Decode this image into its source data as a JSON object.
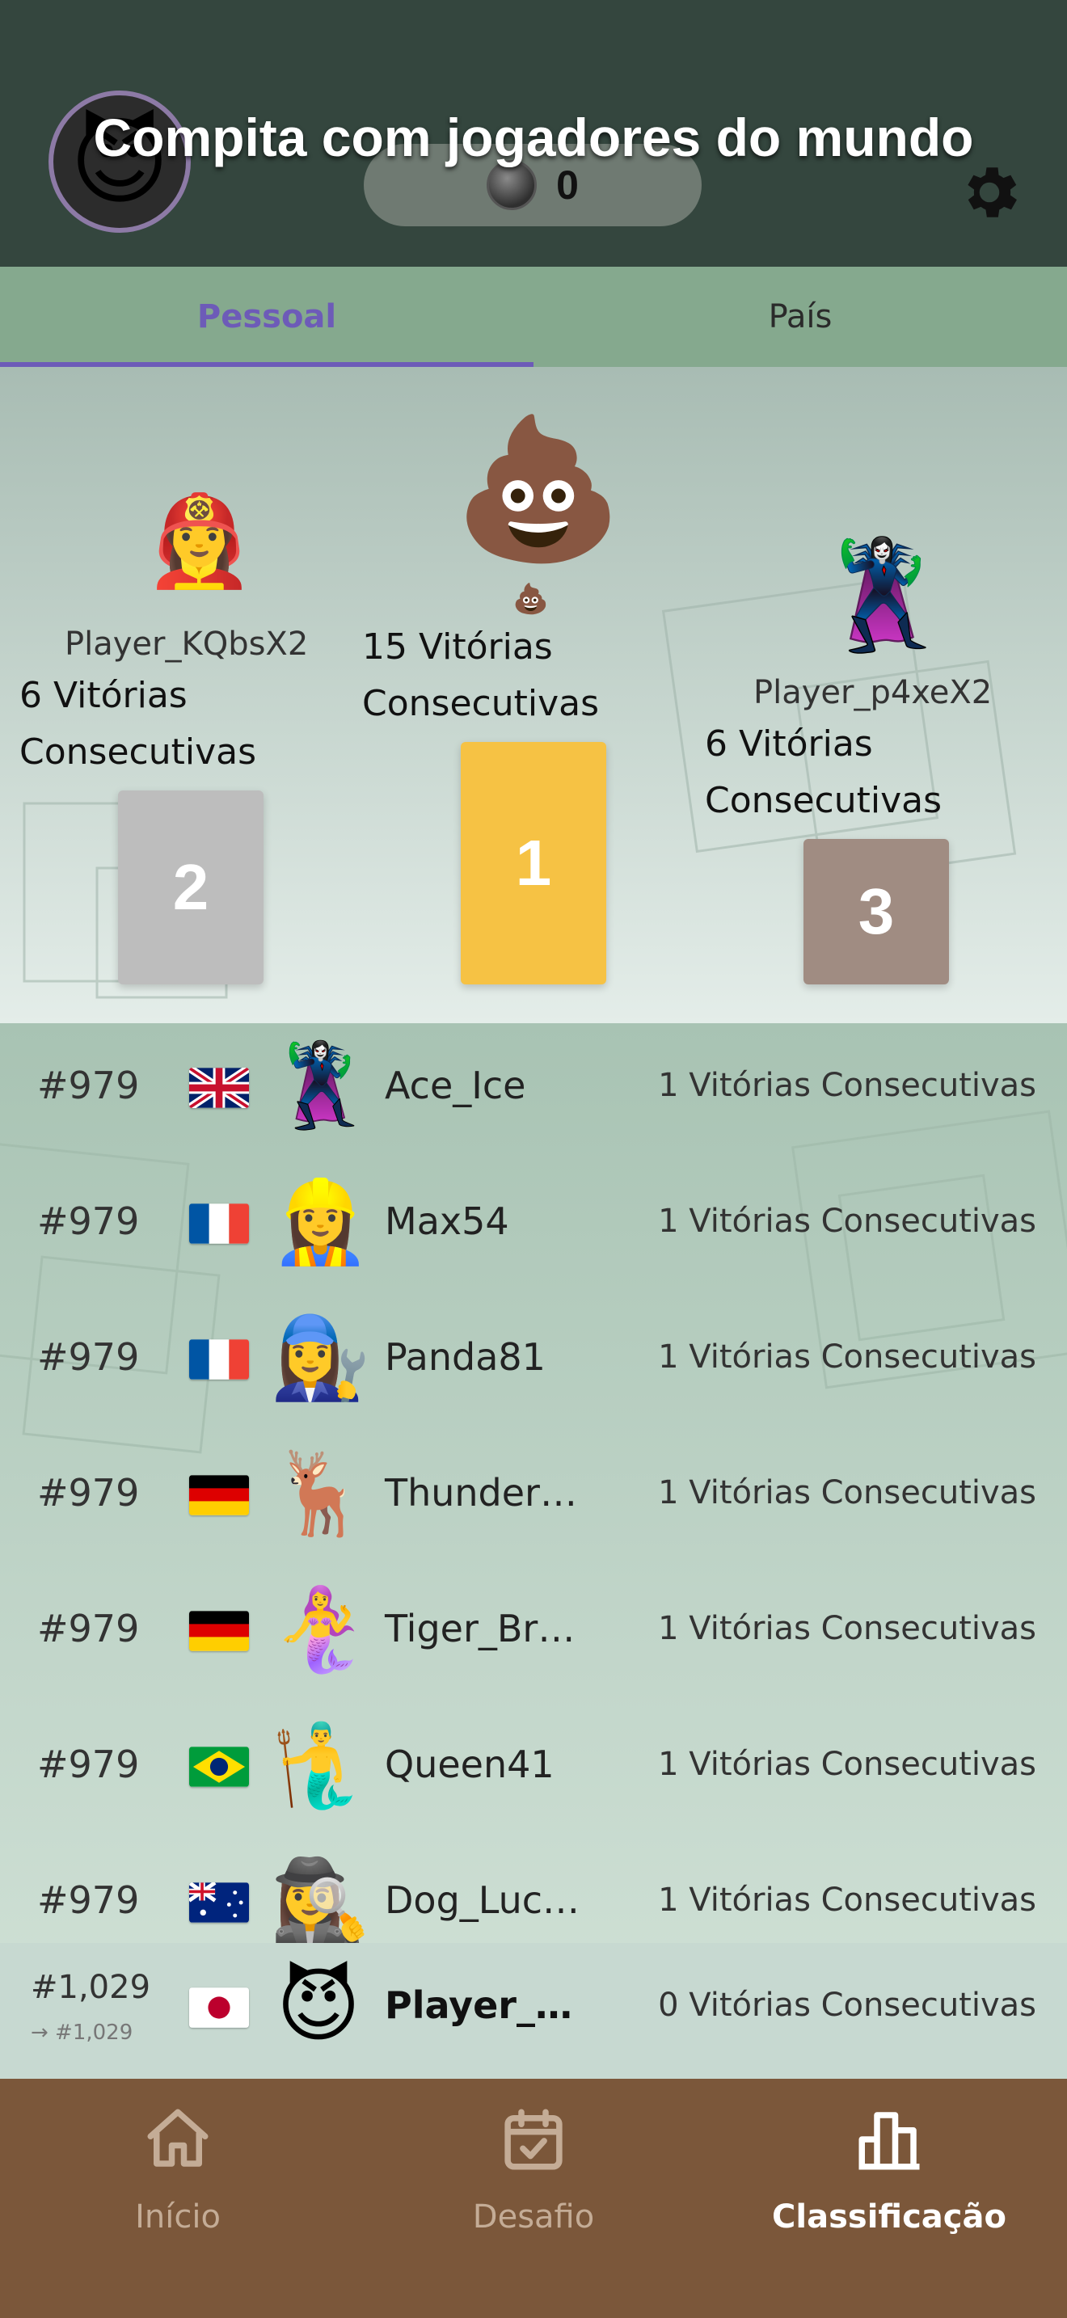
{
  "header": {
    "title": "Compita com jogadores do mundo",
    "coins": "0",
    "avatar_emoji": "😈",
    "avatar_icon": "smiling-devil",
    "settings_icon": "gear-icon"
  },
  "tabs": [
    {
      "label": "Pessoal",
      "active": true
    },
    {
      "label": "País",
      "active": false
    }
  ],
  "podium": {
    "first": {
      "emoji": "💩",
      "badge_emoji": "💩",
      "score": "15 Vitórias Consecutivas",
      "place": "1",
      "color": "#f6c244"
    },
    "second": {
      "emoji": "👩‍🚒",
      "name": "Player_KQbsX2",
      "score": "6 Vitórias Consecutivas",
      "place": "2",
      "color": "#bdbdbd"
    },
    "third": {
      "emoji": "🦹‍♀️",
      "name": "Player_p4xeX2",
      "score": "6 Vitórias Consecutivas",
      "place": "3",
      "color": "#a08c82"
    }
  },
  "leaderboard": [
    {
      "rank": "#979",
      "flag": "gb",
      "avatar": "🦹‍♀️",
      "name": "Ace_Ice",
      "score": "1 Vitórias Consecutivas"
    },
    {
      "rank": "#979",
      "flag": "fr",
      "avatar": "👷‍♀️",
      "name": "Max54",
      "score": "1 Vitórias Consecutivas"
    },
    {
      "rank": "#979",
      "flag": "fr",
      "avatar": "👩‍🔧",
      "name": "Panda81",
      "score": "1 Vitórias Consecutivas"
    },
    {
      "rank": "#979",
      "flag": "de",
      "avatar": "🦌",
      "name": "Thunder…",
      "score": "1 Vitórias Consecutivas"
    },
    {
      "rank": "#979",
      "flag": "de",
      "avatar": "🧜‍♀️",
      "name": "Tiger_Br…",
      "score": "1 Vitórias Consecutivas"
    },
    {
      "rank": "#979",
      "flag": "br",
      "avatar": "🧜‍♂️",
      "name": "Queen41",
      "score": "1 Vitórias Consecutivas"
    },
    {
      "rank": "#979",
      "flag": "au",
      "avatar": "🕵️‍♀️",
      "name": "Dog_Luc…",
      "score": "1 Vitórias Consecutivas"
    }
  ],
  "current_user": {
    "rank": "#1,029",
    "previous_rank": "→ #1,029",
    "flag": "jp",
    "avatar": "😈",
    "name": "Player_…",
    "score": "0 Vitórias Consecutivas"
  },
  "nav": [
    {
      "label": "Início",
      "icon": "home-icon",
      "active": false
    },
    {
      "label": "Desafio",
      "icon": "calendar-check-icon",
      "active": false
    },
    {
      "label": "Classificação",
      "icon": "bar-chart-icon",
      "active": true
    }
  ],
  "colors": {
    "header_bg": "#34463e",
    "tabs_bg": "#85a98e",
    "accent": "#6d5bb8",
    "nav_bg": "#7b573a",
    "nav_inactive": "#c4ac96"
  }
}
